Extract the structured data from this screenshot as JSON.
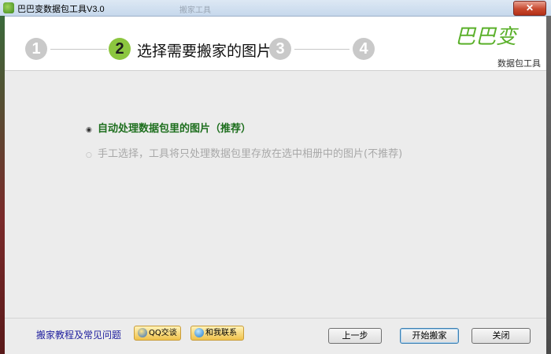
{
  "window": {
    "title": "巴巴变数据包工具V3.0",
    "ghost_title": "搬家工具",
    "close_glyph": "✕"
  },
  "steps": {
    "items": [
      "1",
      "2",
      "3",
      "4"
    ],
    "active_label": "选择需要搬家的图片"
  },
  "logo": {
    "main": "巴巴变",
    "sub": "数据包工具"
  },
  "options": [
    {
      "label": "自动处理数据包里的图片（推荐）",
      "selected": true,
      "enabled": true
    },
    {
      "label": "手工选择，工具将只处理数据包里存放在选中相册中的图片(不推荐)",
      "selected": false,
      "enabled": false
    }
  ],
  "footer": {
    "faq_link": "搬家教程及常见问题",
    "qq_button": "QQ交谈",
    "contact_button": "和我联系",
    "prev_button": "上一步",
    "start_button": "开始搬家",
    "close_button": "关闭"
  },
  "colors": {
    "accent": "#8cc63f",
    "step_inactive": "#c9c9c9",
    "option_selected": "#1d6e1d",
    "link": "#1e1e9e"
  }
}
